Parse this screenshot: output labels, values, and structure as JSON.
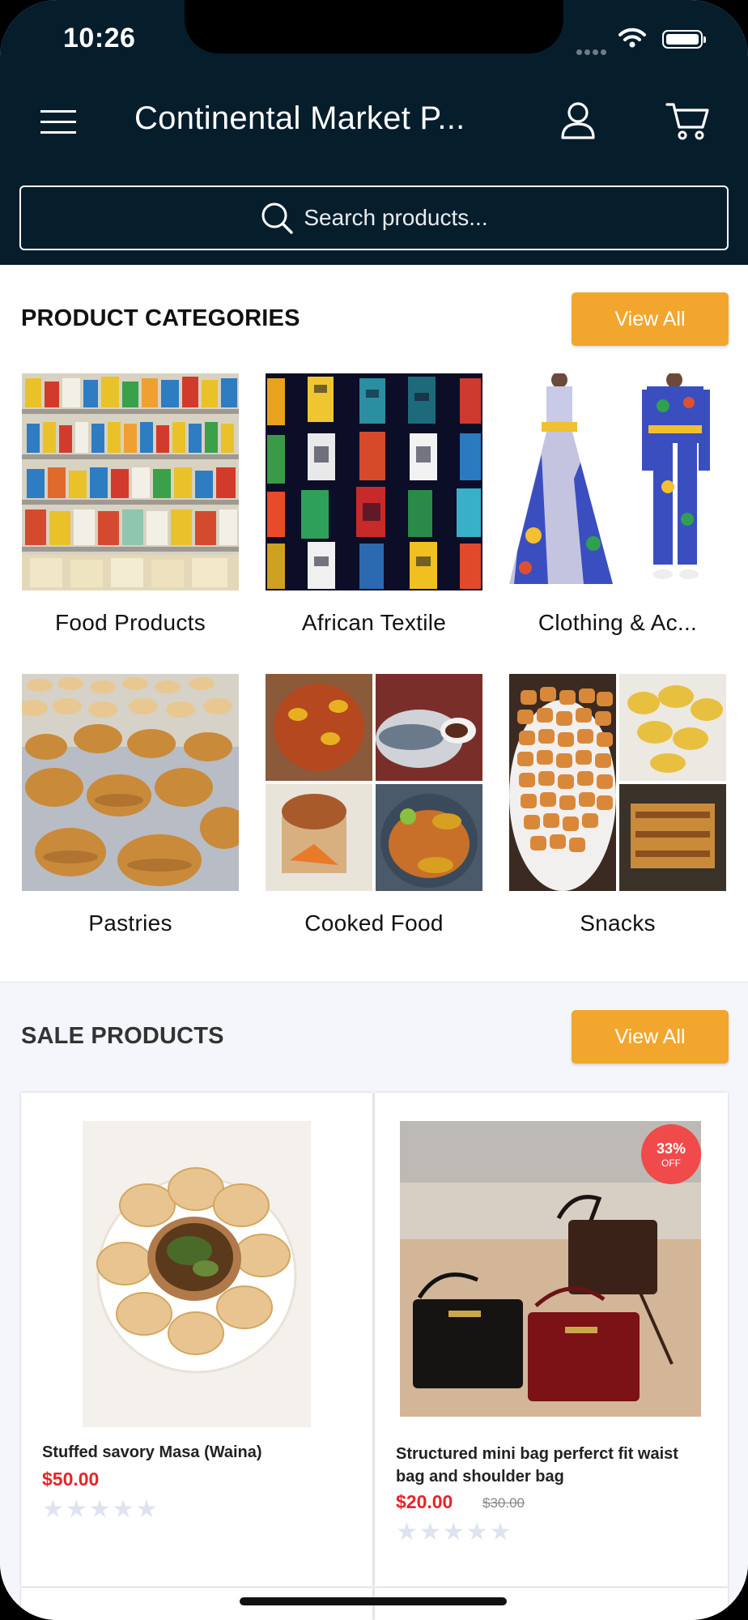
{
  "status_bar": {
    "time": "10:26"
  },
  "header": {
    "title": "Continental Market P...",
    "search_placeholder": "Search products..."
  },
  "categories": {
    "title": "PRODUCT CATEGORIES",
    "view_all": "View All",
    "items": [
      {
        "label": "Food Products"
      },
      {
        "label": "African Textile"
      },
      {
        "label": "Clothing & Ac..."
      },
      {
        "label": "Pastries"
      },
      {
        "label": "Cooked Food"
      },
      {
        "label": "Snacks"
      }
    ]
  },
  "sale": {
    "title": "SALE PRODUCTS",
    "view_all": "View All",
    "products": [
      {
        "name": "Stuffed savory Masa (Waina)",
        "price": "$50.00",
        "old_price": "",
        "rating_stars": "★★★★★",
        "rating": 0
      },
      {
        "name": "Structured mini bag perferct fit waist bag and shoulder bag",
        "price": "$20.00",
        "old_price": "$30.00",
        "rating_stars": "★★★★★",
        "rating": 0,
        "badge_pct": "33%",
        "badge_off": "OFF"
      }
    ]
  },
  "colors": {
    "header_bg": "#061d2c",
    "accent": "#f3a62d",
    "sale_price": "#e8232a",
    "badge": "#f04a4a"
  },
  "icons": [
    "hamburger-menu-icon",
    "user-icon",
    "shopping-cart-icon",
    "search-icon",
    "wifi-icon",
    "battery-icon"
  ]
}
